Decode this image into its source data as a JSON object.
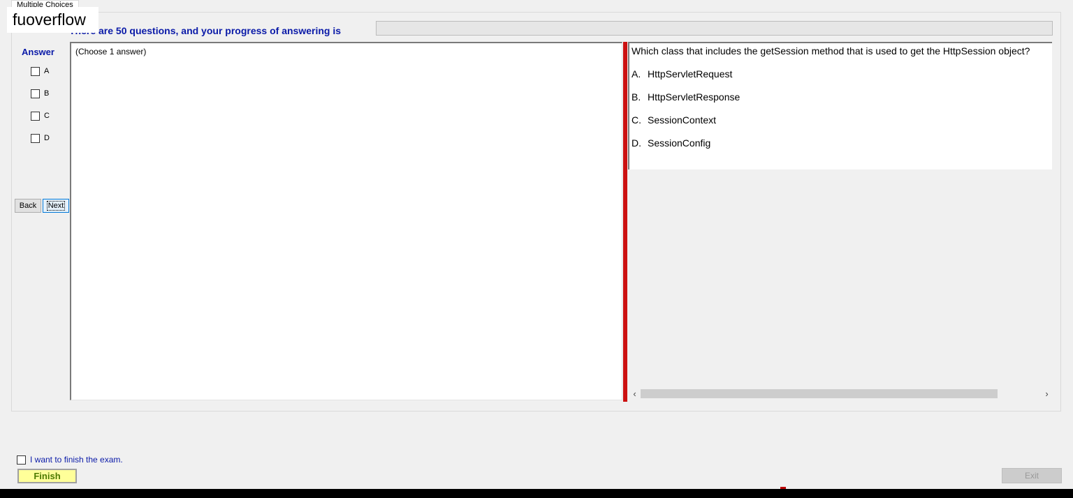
{
  "tab": {
    "label": "Multiple Choices"
  },
  "watermark": "fuoverflow",
  "progress": {
    "title": "There are 50 questions, and your progress of answering is"
  },
  "answer": {
    "label": "Answer",
    "options": [
      "A",
      "B",
      "C",
      "D"
    ],
    "hint": "(Choose 1 answer)"
  },
  "nav": {
    "back": "Back",
    "next": "Next"
  },
  "question": {
    "text": "Which class that includes the getSession method that is used to get the HttpSession object?",
    "choices": [
      {
        "letter": "A.",
        "text": "HttpServletRequest"
      },
      {
        "letter": "B.",
        "text": "HttpServletResponse"
      },
      {
        "letter": "C.",
        "text": "SessionContext"
      },
      {
        "letter": "D.",
        "text": "SessionConfig"
      }
    ]
  },
  "footer": {
    "finish_check": "I want to finish the exam.",
    "finish_button": "Finish",
    "exit_button": "Exit"
  },
  "colors": {
    "accent_blue": "#0a1aa8",
    "splitter_red": "#cc1111",
    "finish_yellow": "#ffff99"
  }
}
